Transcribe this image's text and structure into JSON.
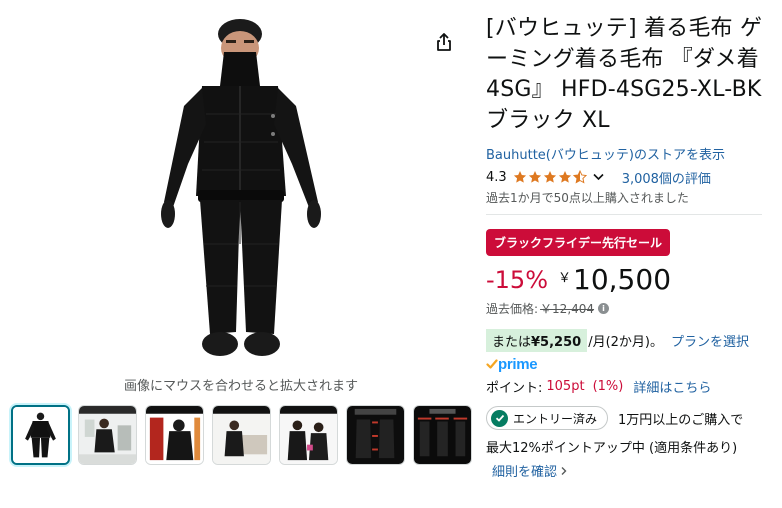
{
  "gallery": {
    "hover_hint": "画像にマウスを合わせると拡大されます",
    "share_icon": "share-icon",
    "thumbnail_count": 7
  },
  "product": {
    "title": "[バウヒュッテ] 着る毛布 ゲーミング着る毛布 『ダメ着4SG』 HFD-4SG25-XL-BK ブラック XL",
    "store_link": "Bauhutte(バウヒュッテ)のストアを表示",
    "rating": "4.3",
    "rating_value": 4.3,
    "reviews": "3,008個の評価",
    "bought": "過去1か月で50点以上購入されました"
  },
  "pricing": {
    "deal_badge": "ブラックフライデー先行セール",
    "discount": "-15%",
    "currency": "￥",
    "price": "10,500",
    "past_price_label": "過去価格:",
    "past_price": "￥12,404",
    "installment_prefix": "または",
    "installment_amount": "¥5,250",
    "installment_term": "/月(2か月)。",
    "plan_link": "プランを選択"
  },
  "prime": {
    "label": "prime"
  },
  "points": {
    "label": "ポイント:",
    "value": "105pt",
    "percent": "(1%)",
    "details_link": "詳細はこちら"
  },
  "promo": {
    "entry_status": "エントリー済み",
    "entry_text": "1万円以上のご購入で",
    "points_up": "最大12%ポイントアップ中 (適用条件あり)",
    "details_link": "細則を確認"
  },
  "colors": {
    "link": "#2162a1",
    "deal_red": "#cc0c39",
    "star": "#de7921",
    "prime_blue": "#1a98ff",
    "installment_bg": "#d7f0dc"
  }
}
